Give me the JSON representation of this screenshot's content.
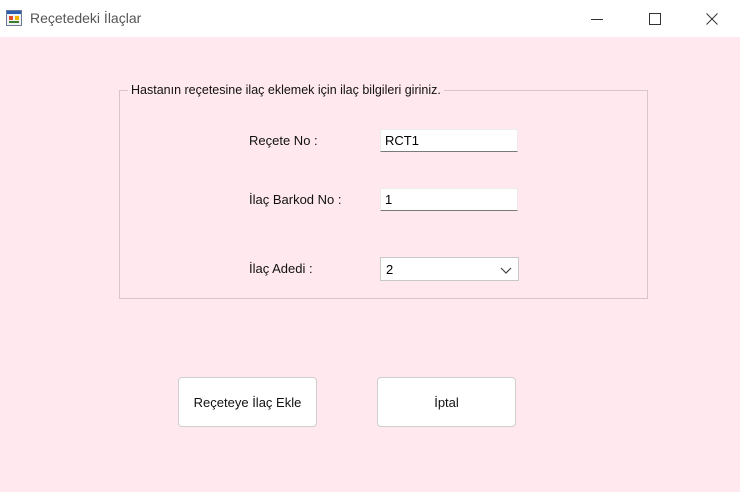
{
  "window": {
    "title": "Reçetedeki İlaçlar",
    "icon": "windows-form-icon",
    "controls": {
      "minimize": "minimize-icon",
      "maximize": "maximize-icon",
      "close": "close-icon"
    }
  },
  "group": {
    "caption": "Hastanın reçetesine ilaç eklemek için ilaç bilgileri giriniz."
  },
  "fields": {
    "recete_label": "Reçete No :",
    "recete_value": "RCT1",
    "barkod_label": "İlaç Barkod No :",
    "barkod_value": "1",
    "adet_label": "İlaç Adedi :",
    "adet_value": "2"
  },
  "buttons": {
    "add_label": "Reçeteye İlaç Ekle",
    "cancel_label": "İptal"
  },
  "colors": {
    "form_background": "#ffe9ef",
    "titlebar": "#ffffff",
    "group_border": "#d7c6cb"
  }
}
